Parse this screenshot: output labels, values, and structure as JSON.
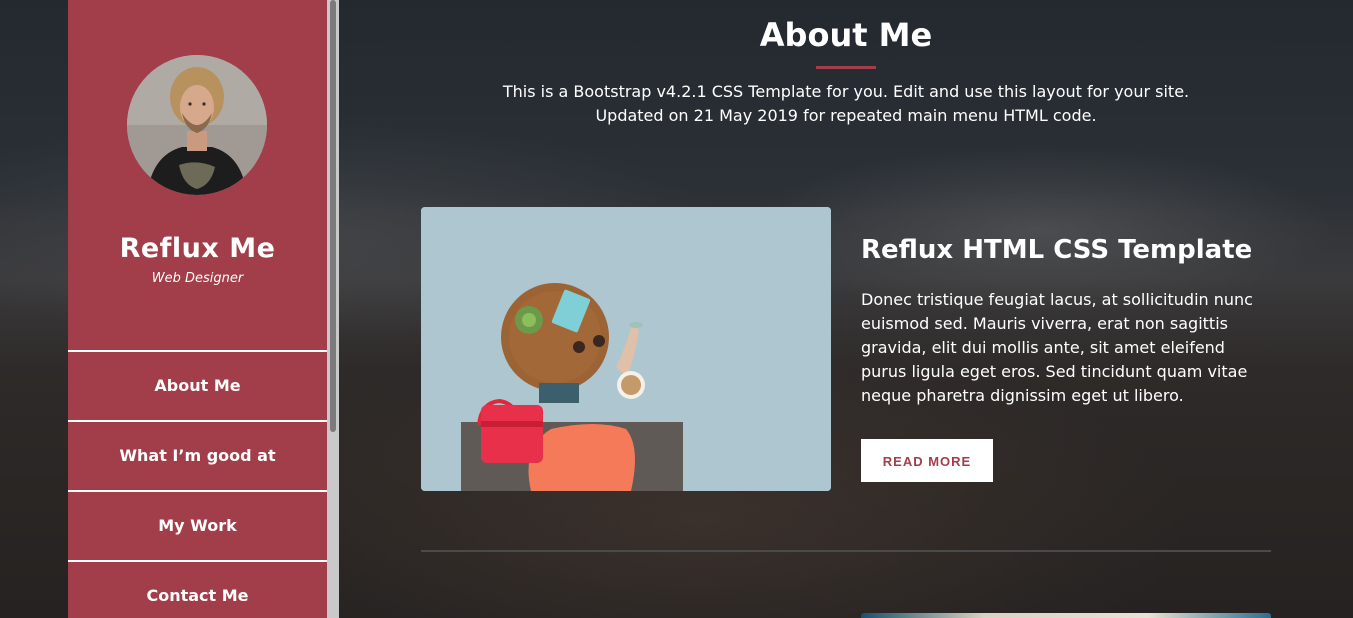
{
  "sidebar": {
    "brand_name": "Reflux Me",
    "brand_role": "Web Designer",
    "nav_items": [
      {
        "label": "About Me"
      },
      {
        "label": "What I’m good at"
      },
      {
        "label": "My Work"
      },
      {
        "label": "Contact Me"
      }
    ]
  },
  "header": {
    "title": "About Me",
    "intro_line1": "This is a Bootstrap v4.2.1 CSS Template for you. Edit and use this layout for your site.",
    "intro_line2": "Updated on 21 May 2019 for repeated main menu HTML code."
  },
  "card": {
    "title": "Reflux HTML CSS Template",
    "text": "Donec tristique feugiat lacus, at sollicitudin nunc euismod sed. Mauris viverra, erat non sagittis gravida, elit dui mollis ante, sit amet eleifend purus ligula eget eros. Sed tincidunt quam vitae neque pharetra dignissim eget ut libero.",
    "button_label": "READ MORE"
  },
  "colors": {
    "accent": "#a23e4a",
    "text": "#ffffff"
  }
}
